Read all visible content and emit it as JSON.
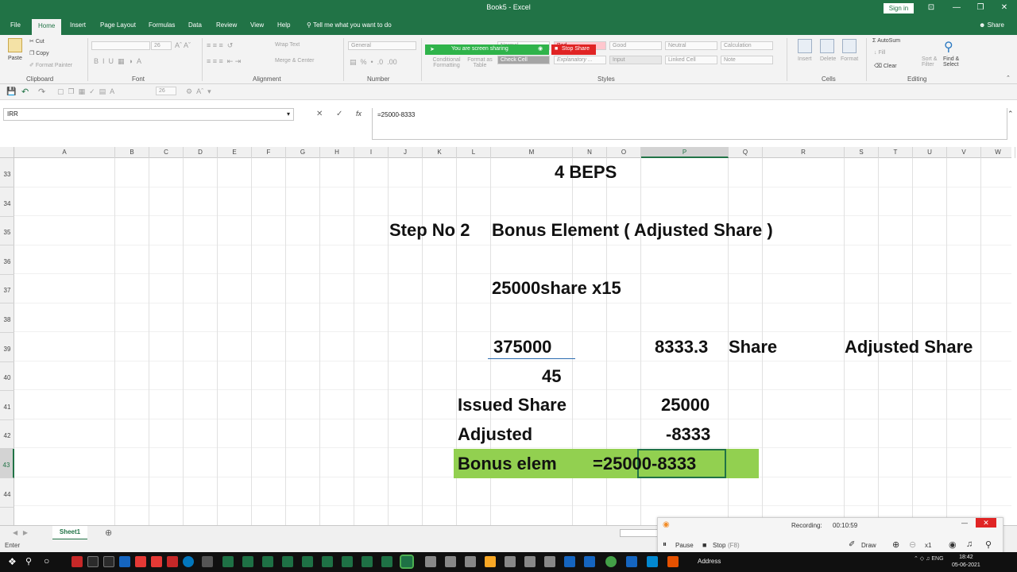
{
  "window": {
    "title": "Book5 - Excel",
    "sign_in": "Sign in",
    "min": "—",
    "max": "❐",
    "close": "✕",
    "ribbon_opt": "⊡"
  },
  "tabs": [
    "File",
    "Home",
    "Insert",
    "Page Layout",
    "Formulas",
    "Data",
    "Review",
    "View",
    "Help"
  ],
  "tell_me": "Tell me what you want to do",
  "share": "Share",
  "clipboard": {
    "cut": "Cut",
    "copy": "Copy",
    "painter": "Format Painter",
    "paste": "Paste",
    "label": "Clipboard"
  },
  "font": {
    "name": "",
    "size": "26",
    "label": "Font"
  },
  "alignment": {
    "wrap": "Wrap Text",
    "merge": "Merge & Center",
    "label": "Alignment"
  },
  "number": {
    "format": "General",
    "label": "Number"
  },
  "styles": {
    "conditional": "Conditional Formatting",
    "format_table": "Format as Table",
    "normal": "Normal",
    "bad": "Bad",
    "good": "Good",
    "neutral": "Neutral",
    "calculation": "Calculation",
    "check_cell": "Check Cell",
    "explanatory": "Explanatory ...",
    "input": "Input",
    "linked_cell": "Linked Cell",
    "note": "Note",
    "label": "Styles"
  },
  "cells_group": {
    "insert": "Insert",
    "delete": "Delete",
    "format": "Format",
    "label": "Cells"
  },
  "editing": {
    "autosum": "AutoSum",
    "fill": "Fill",
    "clear": "Clear",
    "sort": "Sort & Filter",
    "find": "Find & Select",
    "label": "Editing"
  },
  "screen_share": {
    "msg": "You are screen sharing",
    "stop": "Stop Share"
  },
  "qat": {
    "size": "26"
  },
  "formula_bar": {
    "name_box": "IRR",
    "cancel": "✕",
    "enter": "✓",
    "fx": "fx",
    "content": "=25000-8333"
  },
  "columns": [
    "A",
    "B",
    "C",
    "D",
    "E",
    "F",
    "G",
    "H",
    "I",
    "J",
    "K",
    "L",
    "M",
    "N",
    "O",
    "P",
    "Q",
    "R",
    "S",
    "T",
    "U",
    "V",
    "W"
  ],
  "selected_column": "P",
  "rows": [
    "33",
    "34",
    "35",
    "36",
    "37",
    "38",
    "39",
    "40",
    "41",
    "42",
    "43",
    "44"
  ],
  "selected_row": "43",
  "cells": {
    "r33": "4 BEPS",
    "r35_l": "Step No 2",
    "r35_m": "Bonus Element ( Adjusted Share )",
    "r37": "25000share x15",
    "r39_m": "375000",
    "r39_p": "8333.3",
    "r39_q": "Share",
    "r39_t": "Adjusted Share",
    "r40": "45",
    "r41_l": "Issued Share",
    "r41_p": "25000",
    "r42_l": "Adjusted",
    "r42_p": "-8333",
    "r43_l": "Bonus elem",
    "r43_p": "=25000-8333"
  },
  "sheet": {
    "name": "Sheet1",
    "add": "⊕"
  },
  "status": "Enter",
  "recorder": {
    "status": "Recording:",
    "time": "00:10:59",
    "pause": "Pause",
    "stop": "Stop",
    "stop_key": "(F8)",
    "draw": "Draw",
    "zoom": "x1",
    "close": "—"
  },
  "taskbar": {
    "address": "Address",
    "lang": "ENG",
    "time": "18:42",
    "date": "05-06-2021"
  },
  "colors": {
    "excel_green": "#217346",
    "highlight": "#92d050",
    "share_green": "#2fb34a",
    "stop_red": "#e02424"
  }
}
